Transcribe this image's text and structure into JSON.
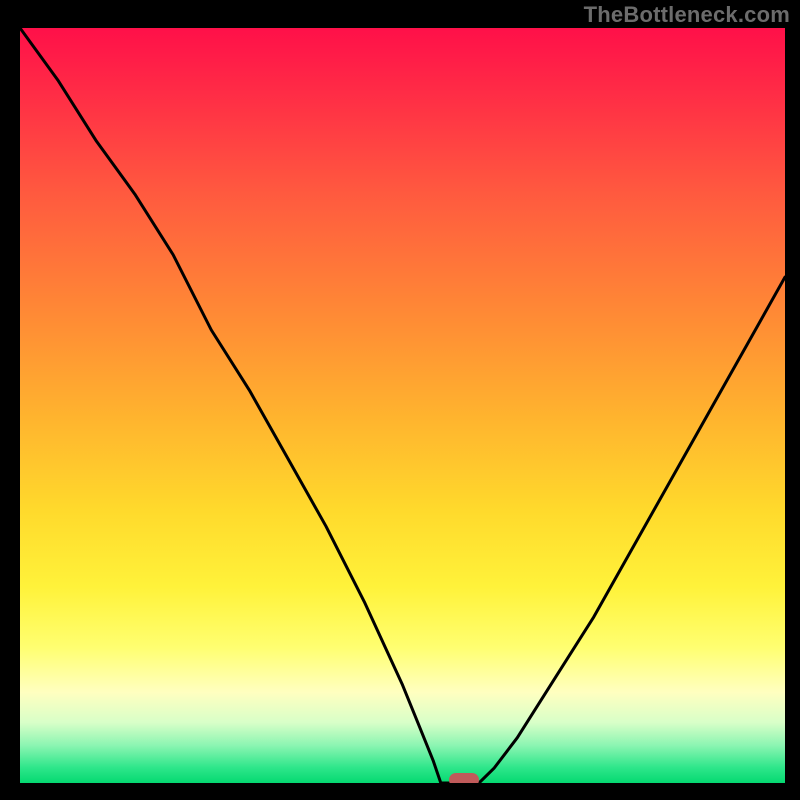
{
  "watermark": "TheBottleneck.com",
  "colors": {
    "frame": "#000000",
    "curve": "#000000",
    "marker": "#c05a5a",
    "gradient_stops": [
      "#ff1049",
      "#ff2a46",
      "#ff5a3f",
      "#ff8a35",
      "#ffb52e",
      "#ffda2c",
      "#fff23a",
      "#ffff70",
      "#ffffc0",
      "#d8ffc8",
      "#8cf5b2",
      "#2de68a",
      "#05d971"
    ]
  },
  "chart_data": {
    "type": "line",
    "title": "",
    "xlabel": "",
    "ylabel": "",
    "xlim": [
      0,
      100
    ],
    "ylim": [
      0,
      100
    ],
    "grid": false,
    "series": [
      {
        "name": "bottleneck-curve",
        "x": [
          0,
          5,
          10,
          15,
          20,
          25,
          30,
          35,
          40,
          45,
          50,
          52,
          54,
          55,
          58,
          60,
          62,
          65,
          70,
          75,
          80,
          85,
          90,
          95,
          100
        ],
        "values": [
          100,
          93,
          85,
          78,
          70,
          60,
          52,
          43,
          34,
          24,
          13,
          8,
          3,
          0,
          0,
          0,
          2,
          6,
          14,
          22,
          31,
          40,
          49,
          58,
          67
        ]
      }
    ],
    "marker": {
      "x": 58,
      "y": 0
    },
    "background_meaning": "vertical gradient encodes bottleneck severity: top=red=high, bottom=green=low"
  }
}
